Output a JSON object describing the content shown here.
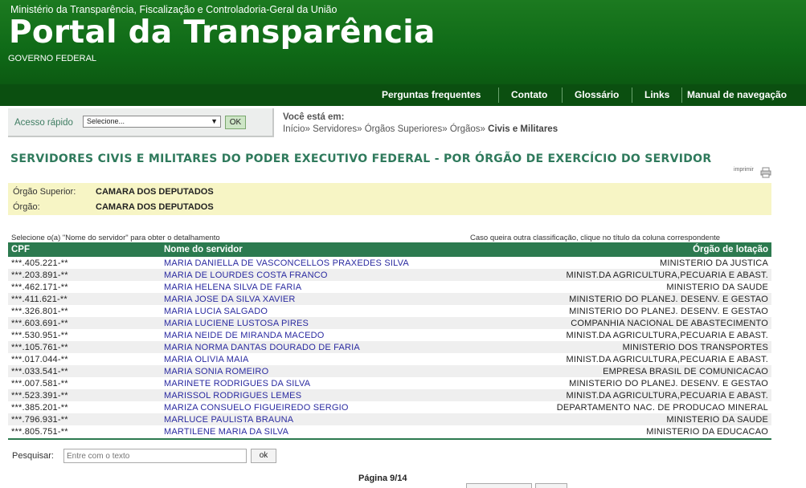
{
  "header": {
    "ministry": "Ministério da Transparência, Fiscalização e Controladoria-Geral da União",
    "title": "Portal da Transparência",
    "subtitle": "GOVERNO FEDERAL"
  },
  "nav": {
    "faq": "Perguntas frequentes",
    "contact": "Contato",
    "glossary": "Glossário",
    "links": "Links",
    "manual": "Manual de navegação"
  },
  "quick_access": {
    "label": "Acesso rápido",
    "selected": "Selecione...",
    "ok": "OK"
  },
  "breadcrumb": {
    "label": "Você está em:",
    "items": [
      "Início",
      "Servidores",
      "Órgãos Superiores",
      "Órgãos"
    ],
    "separator": "»",
    "current": "Civis e Militares"
  },
  "page_title": "SERVIDORES CIVIS E MILITARES DO PODER EXECUTIVO FEDERAL - POR ÓRGÃO DE EXERCÍCIO DO SERVIDOR",
  "print_label": "imprimir",
  "info": {
    "superior_label": "Órgão Superior:",
    "superior_value": "CAMARA DOS DEPUTADOS",
    "organ_label": "Órgão:",
    "organ_value": "CAMARA DOS DEPUTADOS"
  },
  "hints": {
    "left": "Selecione o(a) \"Nome do servidor\" para obter o detalhamento",
    "right": "Caso queira outra classificação, clique no título da coluna correspondente"
  },
  "table": {
    "columns": [
      "CPF",
      "Nome do servidor",
      "Órgão de lotação"
    ],
    "rows": [
      [
        "***.405.221-**",
        "MARIA DANIELLA DE VASCONCELLOS PRAXEDES SILVA",
        "MINISTERIO DA JUSTICA"
      ],
      [
        "***.203.891-**",
        "MARIA DE LOURDES COSTA FRANCO",
        "MINIST.DA AGRICULTURA,PECUARIA E ABAST."
      ],
      [
        "***.462.171-**",
        "MARIA HELENA SILVA DE FARIA",
        "MINISTERIO DA SAUDE"
      ],
      [
        "***.411.621-**",
        "MARIA JOSE DA SILVA XAVIER",
        "MINISTERIO DO PLANEJ. DESENV. E GESTAO"
      ],
      [
        "***.326.801-**",
        "MARIA LUCIA SALGADO",
        "MINISTERIO DO PLANEJ. DESENV. E GESTAO"
      ],
      [
        "***.603.691-**",
        "MARIA LUCIENE LUSTOSA PIRES",
        "COMPANHIA NACIONAL DE ABASTECIMENTO"
      ],
      [
        "***.530.951-**",
        "MARIA NEIDE DE MIRANDA MACEDO",
        "MINIST.DA AGRICULTURA,PECUARIA E ABAST."
      ],
      [
        "***.105.761-**",
        "MARIA NORMA DANTAS DOURADO DE FARIA",
        "MINISTERIO DOS TRANSPORTES"
      ],
      [
        "***.017.044-**",
        "MARIA OLIVIA MAIA",
        "MINIST.DA AGRICULTURA,PECUARIA E ABAST."
      ],
      [
        "***.033.541-**",
        "MARIA SONIA ROMEIRO",
        "EMPRESA BRASIL DE COMUNICACAO"
      ],
      [
        "***.007.581-**",
        "MARINETE RODRIGUES DA SILVA",
        "MINISTERIO DO PLANEJ. DESENV. E GESTAO"
      ],
      [
        "***.523.391-**",
        "MARISSOL RODRIGUES LEMES",
        "MINIST.DA AGRICULTURA,PECUARIA E ABAST."
      ],
      [
        "***.385.201-**",
        "MARIZA CONSUELO FIGUEIREDO SERGIO",
        "DEPARTAMENTO NAC. DE PRODUCAO MINERAL"
      ],
      [
        "***.796.931-**",
        "MARLUCE PAULISTA BRAUNA",
        "MINISTERIO DA SAUDE"
      ],
      [
        "***.805.751-**",
        "MARTILENE MARIA DA SILVA",
        "MINISTERIO DA EDUCACAO"
      ]
    ]
  },
  "search": {
    "label": "Pesquisar:",
    "placeholder": "Entre com o texto",
    "ok": "ok"
  },
  "pagination": {
    "label": "Página 9/14"
  }
}
